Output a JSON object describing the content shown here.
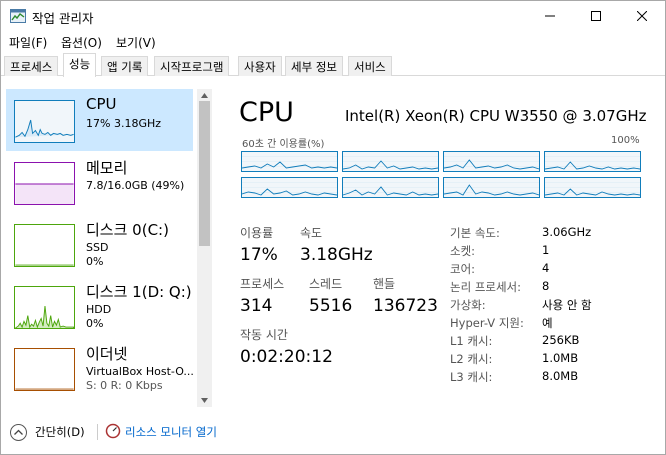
{
  "window": {
    "title": "작업 관리자",
    "icon": "task-manager-icon"
  },
  "menu": [
    "파일(F)",
    "옵션(O)",
    "보기(V)"
  ],
  "tabs": [
    "프로세스",
    "성능",
    "앱 기록",
    "시작프로그램",
    "사용자",
    "세부 정보",
    "서비스"
  ],
  "active_tab": "성능",
  "resources": [
    {
      "name": "CPU",
      "line1": "17% 3.18GHz",
      "line2": "",
      "color": "#117dbb",
      "selected": true
    },
    {
      "name": "메모리",
      "line1": "7.8/16.0GB (49%)",
      "line2": "",
      "color": "#8b12ae",
      "selected": false
    },
    {
      "name": "디스크 0(C:)",
      "line1": "SSD",
      "line2": "0%",
      "color": "#4da60c",
      "selected": false
    },
    {
      "name": "디스크 1(D: Q:)",
      "line1": "HDD",
      "line2": "0%",
      "color": "#4da60c",
      "selected": false
    },
    {
      "name": "이더넷",
      "line1": "VirtualBox Host-O...",
      "line2": "S: 0 R: 0 Kbps",
      "color": "#a74f01",
      "selected": false
    }
  ],
  "cpu": {
    "title": "CPU",
    "model": "Intel(R) Xeon(R) CPU W3550 @ 3.07GHz",
    "graph_label_left": "60초 간 이용률(%)",
    "graph_label_right": "100%",
    "stats": {
      "utilization_label": "이용률",
      "utilization": "17%",
      "speed_label": "속도",
      "speed": "3.18GHz",
      "processes_label": "프로세스",
      "processes": "314",
      "threads_label": "스레드",
      "threads": "5516",
      "handles_label": "핸들",
      "handles": "136723",
      "uptime_label": "작동 시간",
      "uptime": "0:02:20:12"
    },
    "info": [
      {
        "label": "기본 속도:",
        "value": "3.06GHz"
      },
      {
        "label": "소켓:",
        "value": "1"
      },
      {
        "label": "코어:",
        "value": "4"
      },
      {
        "label": "논리 프로세서:",
        "value": "8"
      },
      {
        "label": "가상화:",
        "value": "사용 안 함"
      },
      {
        "label": "Hyper-V 지원:",
        "value": "예"
      },
      {
        "label": "L1 캐시:",
        "value": "256KB"
      },
      {
        "label": "L2 캐시:",
        "value": "1.0MB"
      },
      {
        "label": "L3 캐시:",
        "value": "8.0MB"
      }
    ]
  },
  "footer": {
    "fewer_details": "간단히(D)",
    "resource_monitor": "리소스 모니터 열기"
  },
  "colors": {
    "cpu_line": "#117dbb",
    "selected_bg": "#cce8ff",
    "link": "#0066cc"
  }
}
